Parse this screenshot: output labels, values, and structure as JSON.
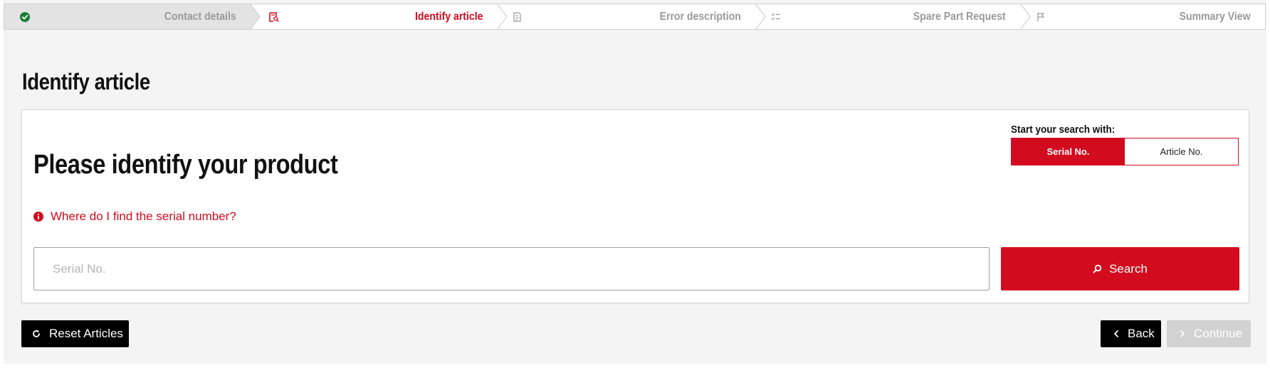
{
  "stepper": {
    "steps": [
      {
        "label": "Contact details",
        "state": "completed",
        "icon": "check-circle-icon"
      },
      {
        "label": "Identify article",
        "state": "active",
        "icon": "search-document-icon"
      },
      {
        "label": "Error description",
        "state": "upcoming",
        "icon": "document-edit-icon"
      },
      {
        "label": "Spare Part Request",
        "state": "upcoming",
        "icon": "checklist-icon"
      },
      {
        "label": "Summary View",
        "state": "upcoming",
        "icon": "flag-icon"
      }
    ]
  },
  "page": {
    "title": "Identify article"
  },
  "card": {
    "title": "Please identify your product",
    "search_with": {
      "label": "Start your search with:",
      "options": [
        "Serial No.",
        "Article No."
      ],
      "selected": "Serial No."
    },
    "help_link": "Where do I find the serial number?",
    "input": {
      "placeholder": "Serial No.",
      "value": ""
    },
    "search_button": "Search"
  },
  "footer": {
    "reset_label": "Reset Articles",
    "back_label": "Back",
    "continue_label": "Continue",
    "continue_enabled": false
  },
  "colors": {
    "accent": "#d30b1f",
    "completed": "#1a7f37",
    "muted": "#9a9a9a",
    "dark": "#000000",
    "disabled": "#d2d2d2"
  }
}
